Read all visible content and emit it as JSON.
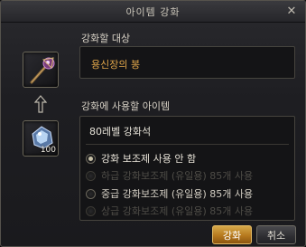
{
  "window": {
    "title": "아이템 강화"
  },
  "target": {
    "section_label": "강화할 대상",
    "item_name": "용신장의 봉",
    "item_icon": "staff-icon"
  },
  "material": {
    "section_label": "강화에 사용할 아이템",
    "item_name": "80레벨 강화석",
    "item_icon": "enhancement-stone-icon",
    "quantity": "100"
  },
  "options": [
    {
      "label": "강화 보조제 사용 안 함",
      "selected": true,
      "enabled": true
    },
    {
      "label": "하급 강화보조제 (유일용) 85개 사용",
      "selected": false,
      "enabled": false
    },
    {
      "label": "중급 강화보조제 (유일용) 85개 사용",
      "selected": false,
      "enabled": true
    },
    {
      "label": "상급 강화보조제 (유일용) 85개 사용",
      "selected": false,
      "enabled": false
    }
  ],
  "buttons": {
    "confirm": "강화",
    "cancel": "취소",
    "close": "✕"
  },
  "colors": {
    "target_name": "#e0a64a",
    "confirm_button": "#c68a2e"
  }
}
